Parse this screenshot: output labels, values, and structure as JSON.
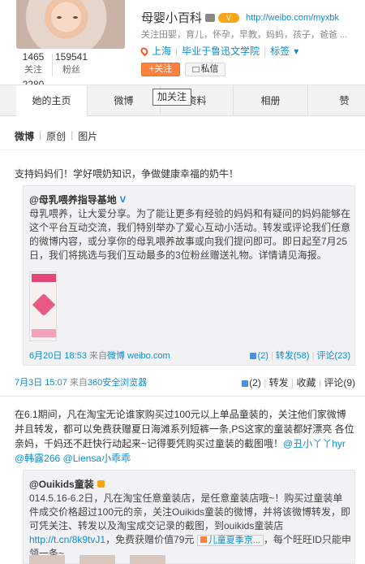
{
  "profile": {
    "name": "母婴小百科",
    "verify_badge": "V",
    "url": "http://weibo.com/myxbk",
    "tags": "关注田婴，育儿，怀孕，早教，妈妈，孩子，爸爸 ...",
    "location": "上海",
    "school": "毕业于鲁迅文学院",
    "tags_label": "标签",
    "follow_label": "+关注",
    "message_label": "私信",
    "stats": {
      "following": "1465",
      "following_label": "关注",
      "followers": "159541",
      "followers_label": "粉丝",
      "posts": "2280"
    }
  },
  "tabs": [
    "她的主页",
    "微博",
    "",
    "资料",
    "相册",
    "赞"
  ],
  "tooltip": "加关注",
  "subnav": {
    "weibo": "微博",
    "original": "原创",
    "images": "图片"
  },
  "post1": {
    "text": "支持妈妈们！学好喂奶知识，争做健康幸福的奶牛！",
    "quote": {
      "author": "@母乳喂养指导基地",
      "verified": "V",
      "body": "母乳喂养，让大爱分享。为了能让更多有经验的妈妈和有疑问的妈妈能够在这个平台互动交流，我们特别举办了爱心互动小活动。转发或评论我们任意的微博内容，或分享你的母乳喂养故事或向我们提问即可。即日起至7月25日，我们将挑选与我们互动最多的3位粉丝赠送礼物。详情请见海报。",
      "time": "6月20日 18:53",
      "source_prefix": "来自",
      "source": "微博 weibo.com",
      "likes": "(2)",
      "repost": "转发(58)",
      "comment": "评论(23)"
    },
    "time": "7月3日 15:07",
    "source_prefix": "来自",
    "source": "360安全浏览器",
    "likes": "(2)",
    "repost": "转发",
    "favorite": "收藏",
    "comment": "评论(9)"
  },
  "post2": {
    "text": "在6.1期间，凡在淘宝无论谁家购买过100元以上单品童装的，关注他们家微博并且转发，都可以免费获赠夏日海滩系列短裤一条,PS这家的童装都好漂亮 各位亲妈，千妈还不赶快行动起来~记得要凭购买过童装的截图哦！",
    "mention1": "@丑小丫丫hyr",
    "mention2": "@韩露266",
    "mention3": "@Liensa小乖乖",
    "quote": {
      "author": "@Ouikids童装",
      "body_pre": "014.5.16-6.2日，凡在淘宝任意童装店，是任意童装店哦~！购买过童装单件成交价格超过100元的亲，关注Ouikids童装的微博，并将该微博转发，即可凭关注、转发以及淘宝成交记录的截图，到ouikids童装店",
      "link": "http://t.cn/8k9tvJ1",
      "body_mid": "，免费获赠价值79元",
      "ad": "儿童夏季京...",
      "body_post": "，每个旺旺ID只能申领一条~"
    }
  },
  "colors": {
    "link": "#0a8cd2",
    "follow": "#ff8140",
    "badge": "#f7a618"
  }
}
